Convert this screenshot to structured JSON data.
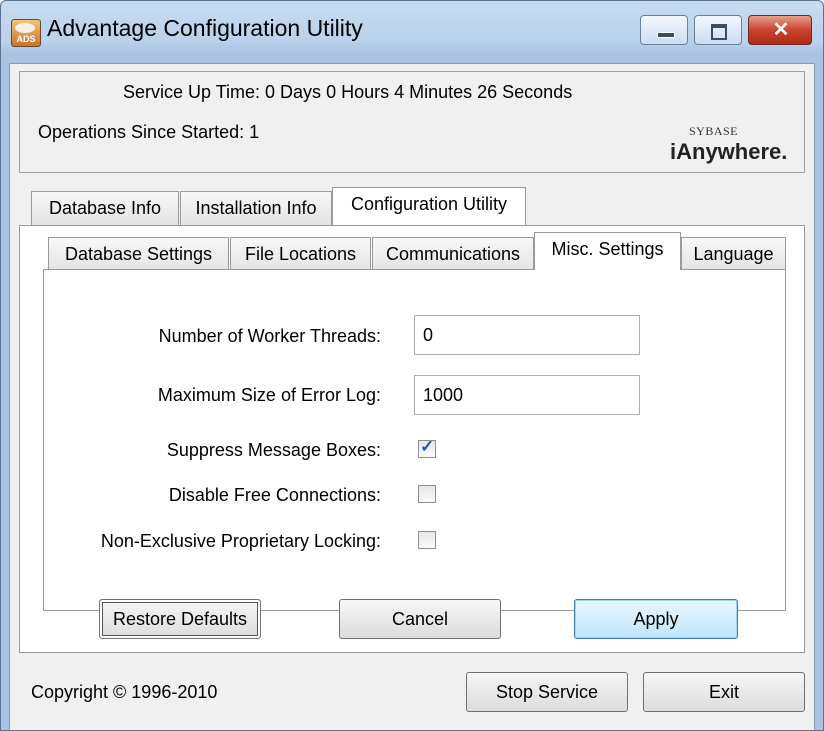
{
  "window": {
    "title": "Advantage Configuration Utility",
    "icon_text": "ADS",
    "close_glyph": "✕"
  },
  "header": {
    "uptime_text": "Service Up Time:  0 Days 0 Hours 4 Minutes 26 Seconds",
    "operations_text": "Operations Since Started: 1",
    "logo_top": "SYBASE",
    "logo_main": "iAnywhere."
  },
  "tabs": [
    {
      "label": "Database Info",
      "active": false
    },
    {
      "label": "Installation Info",
      "active": false
    },
    {
      "label": "Configuration Utility",
      "active": true
    }
  ],
  "subtabs": [
    {
      "label": "Database Settings",
      "active": false
    },
    {
      "label": "File Locations",
      "active": false
    },
    {
      "label": "Communications",
      "active": false
    },
    {
      "label": "Misc. Settings",
      "active": true
    },
    {
      "label": "Language",
      "active": false
    }
  ],
  "settings": {
    "worker_threads_label": "Number of Worker Threads:",
    "worker_threads_value": "0",
    "error_log_label": "Maximum Size of Error Log:",
    "error_log_value": "1000",
    "suppress_label": "Suppress Message Boxes:",
    "suppress_checked": true,
    "disable_free_label": "Disable Free Connections:",
    "disable_free_checked": false,
    "non_exclusive_label": "Non-Exclusive Proprietary Locking:",
    "non_exclusive_checked": false
  },
  "buttons": {
    "restore": "Restore Defaults",
    "cancel": "Cancel",
    "apply": "Apply",
    "stop_service": "Stop Service",
    "exit": "Exit"
  },
  "footer": {
    "copyright": "Copyright © 1996-2010"
  }
}
